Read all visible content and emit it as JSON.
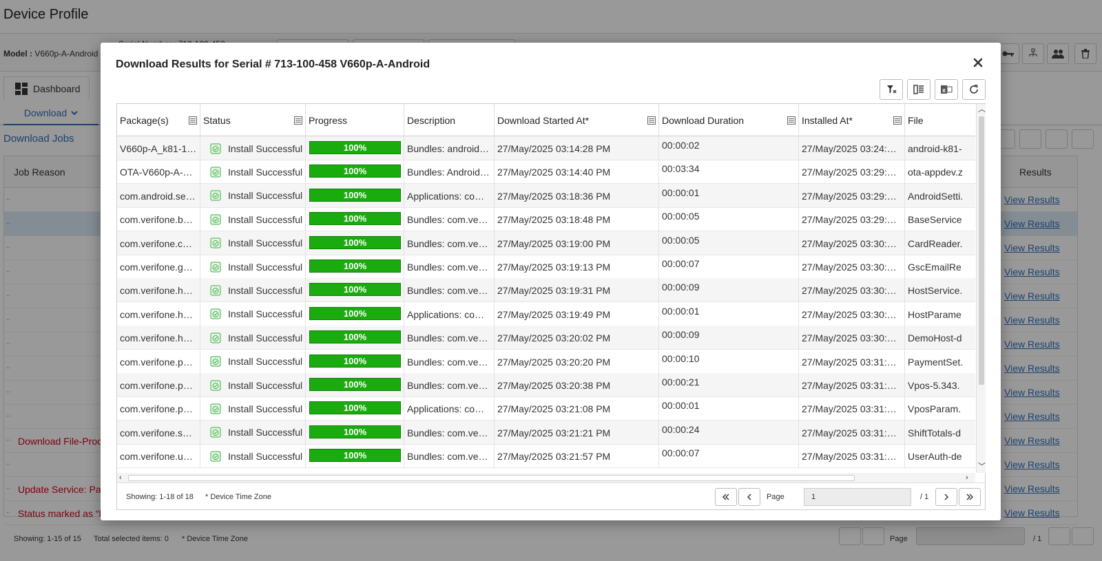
{
  "background": {
    "page_title": "Device Profile",
    "model_label": "Model :",
    "model_value": "V660p-A-Android",
    "serial_label": "Serial Number : 713-100-458",
    "dashboard_tab": "Dashboard",
    "download_tab": "Download",
    "download_jobs_link": "Download Jobs",
    "col_job_reason": "Job Reason",
    "col_results": "Results",
    "rows": [
      {
        "reason": "",
        "results": "View Results"
      },
      {
        "reason": "",
        "results": "View Results"
      },
      {
        "reason": "",
        "results": "View Results"
      },
      {
        "reason": "",
        "results": "View Results"
      },
      {
        "reason": "",
        "results": "View Results"
      },
      {
        "reason": "",
        "results": "View Results"
      },
      {
        "reason": "",
        "results": "View Results"
      },
      {
        "reason": "",
        "results": "View Results"
      },
      {
        "reason": "",
        "results": "View Results"
      },
      {
        "reason": "",
        "results": "View Results"
      },
      {
        "reason": "Download File-Proce",
        "results": "View Results"
      },
      {
        "reason": "",
        "results": "View Results"
      },
      {
        "reason": "Update Service: Pac",
        "results": "View Results"
      },
      {
        "reason": "Status marked as “In",
        "results": "View Results"
      }
    ],
    "footer_showing": "Showing: 1-15 of 15",
    "footer_selected": "Total selected items: 0",
    "footer_tz": "* Device Time Zone",
    "page_label": "Page",
    "page_value": "1",
    "page_total": "/ 1"
  },
  "modal": {
    "title": "Download Results for Serial # 713-100-458 V660p-A-Android",
    "columns": [
      "Package(s)",
      "Status",
      "Progress",
      "Description",
      "Download Started At*",
      "Download Duration",
      "Installed At*",
      "File"
    ],
    "rows": [
      {
        "package": "V660p-A_k81-1.…",
        "status": "Install Successful",
        "progress": 100,
        "progress_label": "100%",
        "description": "Bundles: android-k…",
        "started": "27/May/2025 03:14:28 PM",
        "duration": "00:00:02",
        "installed": "27/May/2025 03:24:26…",
        "file": "android-k81-"
      },
      {
        "package": "OTA-V660p-A-6.…",
        "status": "Install Successful",
        "progress": 100,
        "progress_label": "100%",
        "description": "Bundles: Android …",
        "started": "27/May/2025 03:14:40 PM",
        "duration": "00:03:34",
        "installed": "27/May/2025 03:29:27…",
        "file": "ota-appdev.z"
      },
      {
        "package": "com.android.sett…",
        "status": "Install Successful",
        "progress": 100,
        "progress_label": "100%",
        "description": "Applications: com.…",
        "started": "27/May/2025 03:18:36 PM",
        "duration": "00:00:01",
        "installed": "27/May/2025 03:29:42…",
        "file": "AndroidSetti."
      },
      {
        "package": "com.verifone.ba…",
        "status": "Install Successful",
        "progress": 100,
        "progress_label": "100%",
        "description": "Bundles: com.verif…",
        "started": "27/May/2025 03:18:48 PM",
        "duration": "00:00:05",
        "installed": "27/May/2025 03:29:54…",
        "file": "BaseService"
      },
      {
        "package": "com.verifone.car…",
        "status": "Install Successful",
        "progress": 100,
        "progress_label": "100%",
        "description": "Bundles: com.verif…",
        "started": "27/May/2025 03:19:00 PM",
        "duration": "00:00:05",
        "installed": "27/May/2025 03:30:06…",
        "file": "CardReader."
      },
      {
        "package": "com.verifone.gs…",
        "status": "Install Successful",
        "progress": 100,
        "progress_label": "100%",
        "description": "Bundles: com.verif…",
        "started": "27/May/2025 03:19:13 PM",
        "duration": "00:00:07",
        "installed": "27/May/2025 03:30:18…",
        "file": "GscEmailRe"
      },
      {
        "package": "com.verifone.ho…",
        "status": "Install Successful",
        "progress": 100,
        "progress_label": "100%",
        "description": "Bundles: com.verif…",
        "started": "27/May/2025 03:19:31 PM",
        "duration": "00:00:09",
        "installed": "27/May/2025 03:30:30…",
        "file": "HostService."
      },
      {
        "package": "com.verifone.ho…",
        "status": "Install Successful",
        "progress": 100,
        "progress_label": "100%",
        "description": "Applications: com.…",
        "started": "27/May/2025 03:19:49 PM",
        "duration": "00:00:01",
        "installed": "27/May/2025 03:30:42…",
        "file": "HostParame"
      },
      {
        "package": "com.verifone.ho…",
        "status": "Install Successful",
        "progress": 100,
        "progress_label": "100%",
        "description": "Bundles: com.verif…",
        "started": "27/May/2025 03:20:02 PM",
        "duration": "00:00:09",
        "installed": "27/May/2025 03:30:54…",
        "file": "DemoHost-d"
      },
      {
        "package": "com.verifone.pa…",
        "status": "Install Successful",
        "progress": 100,
        "progress_label": "100%",
        "description": "Bundles: com.verif…",
        "started": "27/May/2025 03:20:20 PM",
        "duration": "00:00:10",
        "installed": "27/May/2025 03:31:07…",
        "file": "PaymentSet."
      },
      {
        "package": "com.verifone.po…",
        "status": "Install Successful",
        "progress": 100,
        "progress_label": "100%",
        "description": "Bundles: com.verif…",
        "started": "27/May/2025 03:20:38 PM",
        "duration": "00:00:21",
        "installed": "27/May/2025 03:31:20…",
        "file": "Vpos-5.343."
      },
      {
        "package": "com.verifone.po…",
        "status": "Install Successful",
        "progress": 100,
        "progress_label": "100%",
        "description": "Applications: com.…",
        "started": "27/May/2025 03:21:08 PM",
        "duration": "00:00:01",
        "installed": "27/May/2025 03:31:32…",
        "file": "VposParam."
      },
      {
        "package": "com.verifone.shi…",
        "status": "Install Successful",
        "progress": 100,
        "progress_label": "100%",
        "description": "Bundles: com.verif…",
        "started": "27/May/2025 03:21:21 PM",
        "duration": "00:00:24",
        "installed": "27/May/2025 03:31:44…",
        "file": "ShiftTotals-d"
      },
      {
        "package": "com.verifone.us…",
        "status": "Install Successful",
        "progress": 100,
        "progress_label": "100%",
        "description": "Bundles: com.verif…",
        "started": "27/May/2025 03:21:57 PM",
        "duration": "00:00:07",
        "installed": "27/May/2025 03:31:55…",
        "file": "UserAuth-de"
      }
    ],
    "footer_showing": "Showing: 1-18 of 18",
    "footer_tz": "* Device Time Zone",
    "page_label": "Page",
    "page_value": "1",
    "page_total": "/ 1",
    "colors": {
      "progress_fill": "#1aac0e",
      "status_icon": "#3cb043"
    }
  }
}
